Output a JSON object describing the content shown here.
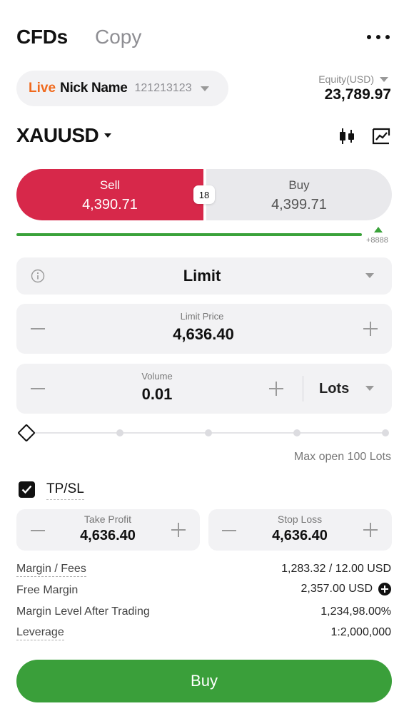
{
  "header": {
    "tabs": [
      {
        "label": "CFDs",
        "active": true
      },
      {
        "label": "Copy",
        "active": false
      }
    ],
    "more_icon": "more-horizontal-icon"
  },
  "account": {
    "type": "Live",
    "name": "Nick Name",
    "number": "121213123",
    "equity_label": "Equity(USD)",
    "equity_value": "23,789.97"
  },
  "symbol": {
    "name": "XAUUSD",
    "icons": [
      "candlestick-icon",
      "chart-trend-icon"
    ]
  },
  "quote": {
    "sell_label": "Sell",
    "sell_price": "4,390.71",
    "buy_label": "Buy",
    "buy_price": "4,399.71",
    "spread": "18",
    "change": "+8888"
  },
  "order": {
    "type": "Limit",
    "limit_price_label": "Limit Price",
    "limit_price": "4,636.40",
    "volume_label": "Volume",
    "volume": "0.01",
    "volume_unit": "Lots",
    "max_open": "Max open 100 Lots",
    "volume_fraction": 0
  },
  "tpsl": {
    "label": "TP/SL",
    "checked": true,
    "take_profit_label": "Take Profit",
    "take_profit": "4,636.40",
    "stop_loss_label": "Stop Loss",
    "stop_loss": "4,636.40"
  },
  "summary": [
    {
      "label": "Margin / Fees",
      "value": "1,283.32 / 12.00 USD"
    },
    {
      "label": "Free Margin",
      "value": "2,357.00 USD"
    },
    {
      "label": "Margin Level After Trading",
      "value": "1,234,98.00%"
    },
    {
      "label": "Leverage",
      "value": "1:2,000,000"
    }
  ],
  "submit_label": "Buy",
  "colors": {
    "sell": "#d7284a",
    "buy_action": "#3a9f3a",
    "live": "#f06a1e"
  }
}
